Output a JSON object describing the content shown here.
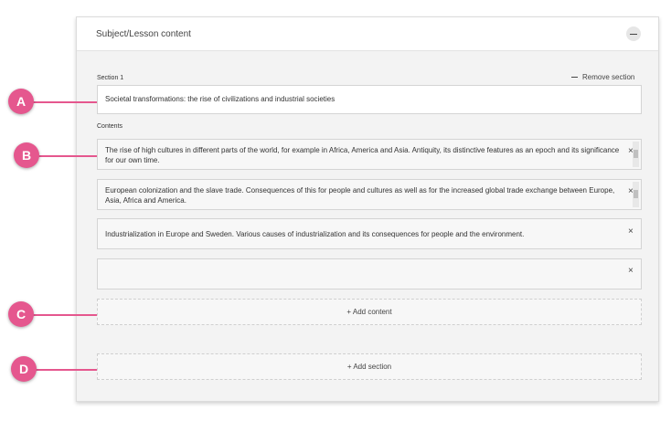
{
  "panel": {
    "title": "Subject/Lesson content"
  },
  "section": {
    "label": "Section 1",
    "remove_label": "Remove section",
    "title_value": "Societal transformations: the rise of civilizations and industrial societies"
  },
  "contents": {
    "label": "Contents",
    "items": [
      {
        "text": "The rise of high cultures in different parts of the world, for example in Africa, America and Asia. Antiquity, its distinctive features as an epoch and its significance for our own time."
      },
      {
        "text": "European colonization and the slave trade. Consequences of this for people and cultures as well as for the increased global trade exchange between Europe, Asia, Africa and America."
      },
      {
        "text": "Industrialization in Europe and Sweden. Various causes of industrialization and its consequences for people and the environment."
      },
      {
        "text": ""
      }
    ]
  },
  "buttons": {
    "add_content": "+ Add content",
    "add_section": "+ Add section"
  },
  "markers": [
    "A",
    "B",
    "C",
    "D"
  ],
  "icons": {
    "close": "×",
    "collapse": "minus-icon"
  },
  "colors": {
    "accent": "#e5578e"
  }
}
